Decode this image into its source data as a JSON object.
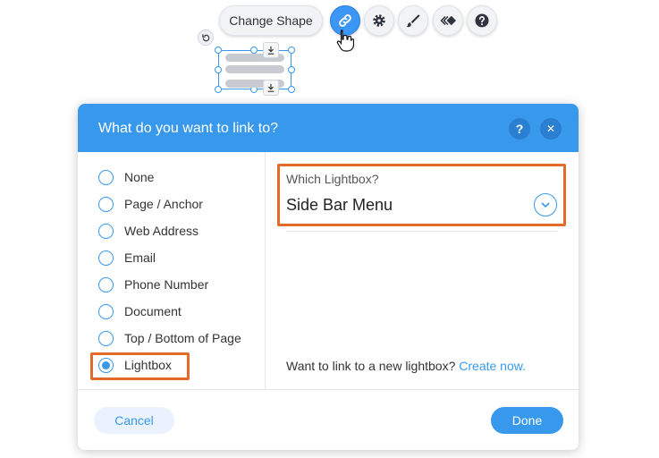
{
  "toolbar": {
    "change_shape_label": "Change Shape",
    "icons": [
      "link-icon",
      "gear-icon",
      "brush-icon",
      "animation-icon",
      "help-icon"
    ],
    "accent": "#3b96f5"
  },
  "dialog": {
    "title": "What do you want to link to?",
    "help_icon": "?",
    "close_icon": "✕",
    "options": [
      {
        "label": "None",
        "checked": false
      },
      {
        "label": "Page / Anchor",
        "checked": false
      },
      {
        "label": "Web Address",
        "checked": false
      },
      {
        "label": "Email",
        "checked": false
      },
      {
        "label": "Phone Number",
        "checked": false
      },
      {
        "label": "Document",
        "checked": false
      },
      {
        "label": "Top / Bottom of Page",
        "checked": false
      },
      {
        "label": "Lightbox",
        "checked": true
      }
    ],
    "lightbox": {
      "label": "Which Lightbox?",
      "selected": "Side Bar Menu"
    },
    "new_lightbox": {
      "text": "Want to link to a new lightbox?",
      "link": "Create now."
    },
    "cancel_label": "Cancel",
    "done_label": "Done"
  },
  "colors": {
    "header": "#3899ec",
    "highlight": "#e26b2a"
  }
}
